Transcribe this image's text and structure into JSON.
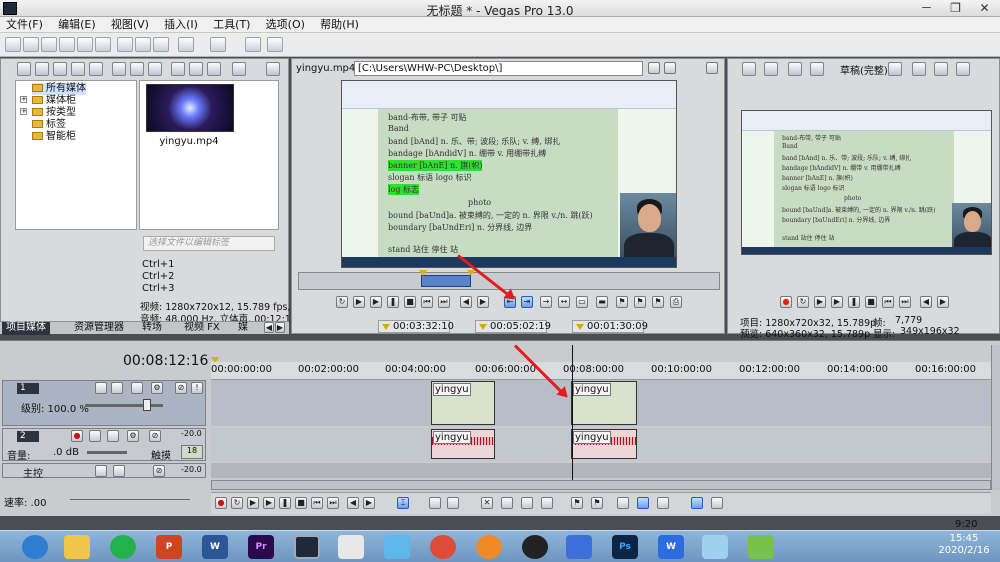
{
  "window": {
    "title": "无标题 * - Vegas Pro 13.0",
    "controls": [
      "－",
      "❐",
      "✕"
    ]
  },
  "menu": [
    "文件(F)",
    "编辑(E)",
    "视图(V)",
    "插入(I)",
    "工具(T)",
    "选项(O)",
    "帮助(H)"
  ],
  "media_panel": {
    "tree": [
      "所有媒体",
      "媒体柜",
      "按类型",
      "标签",
      "智能柜"
    ],
    "clip_name": "yingyu.mp4",
    "search_placeholder": "选择文件以编辑标签",
    "shortcuts": [
      "Ctrl+1",
      "Ctrl+2",
      "Ctrl+3"
    ],
    "video_info": "视频: 1280x720x12, 15.789 fps, 0",
    "audio_info": "音频: 48,000 Hz, 立体声, 00:12:1",
    "tabs": [
      "项目媒体",
      "资源管理器",
      "转场",
      "视频 FX",
      "媒"
    ]
  },
  "trimmer": {
    "file": "yingyu.mp4",
    "path": "[C:\\Users\\WHW-PC\\Desktop\\]",
    "time_in": "00:03:32:10",
    "time_out": "00:05:02:19",
    "duration": "00:01:30:09"
  },
  "document_lines": [
    "band-布带, 带子 可贴",
    "Band",
    "band [bAnd]  n. 乐、带; 波段; 乐队; v. 缚, 绑扎",
    "bandage [bAndidV]  n. 绷带 v. 用绷带扎缚",
    "banner  [bAnE]  n. 旗(帜)",
    "slogan  标语  logo  标识",
    "log 标志",
    "photo",
    "bound  [baUnd]a. 被束缚的, 一定的  n. 界限 v./n. 跳(跃)",
    "boundary [baUndEri]  n. 分界线, 边界",
    "stand  站住  停住 站"
  ],
  "preview": {
    "mode": "草稿(完整)",
    "project_info": "项目: 1280x720x32, 15.789p",
    "preview_info": "预览: 640x360x32, 15.789p",
    "frame_label": "帧:",
    "frame_value": "7,779",
    "display_label": "显示:",
    "display_value": "349x196x32"
  },
  "timeline": {
    "current_time": "00:08:12:16",
    "ruler": [
      "00:00:00:00",
      "00:02:00:00",
      "00:04:00:00",
      "00:06:00:00",
      "00:08:00:00",
      "00:10:00:00",
      "00:12:00:00",
      "00:14:00:00",
      "00:16:00:00"
    ],
    "video_track": {
      "number": "1",
      "level_label": "级别: 100.0 %"
    },
    "audio_track": {
      "number": "2",
      "volume_label": "音量:",
      "volume_value": ".0 dB",
      "pan_label": "触摸",
      "db_a": "-20.0",
      "db_b": "-20.0",
      "scale": "18"
    },
    "master_label": "主控",
    "rate_label": "速率: .00",
    "event_name": "yingyu",
    "end_time": "9:20"
  },
  "taskbar": {
    "time": "15:45",
    "date": "2020/2/16"
  },
  "colors": {
    "accent": "#1d5fc9",
    "arrow": "#e31c1c",
    "track_header": "#2d3440",
    "highlight": "#2fe02f"
  }
}
